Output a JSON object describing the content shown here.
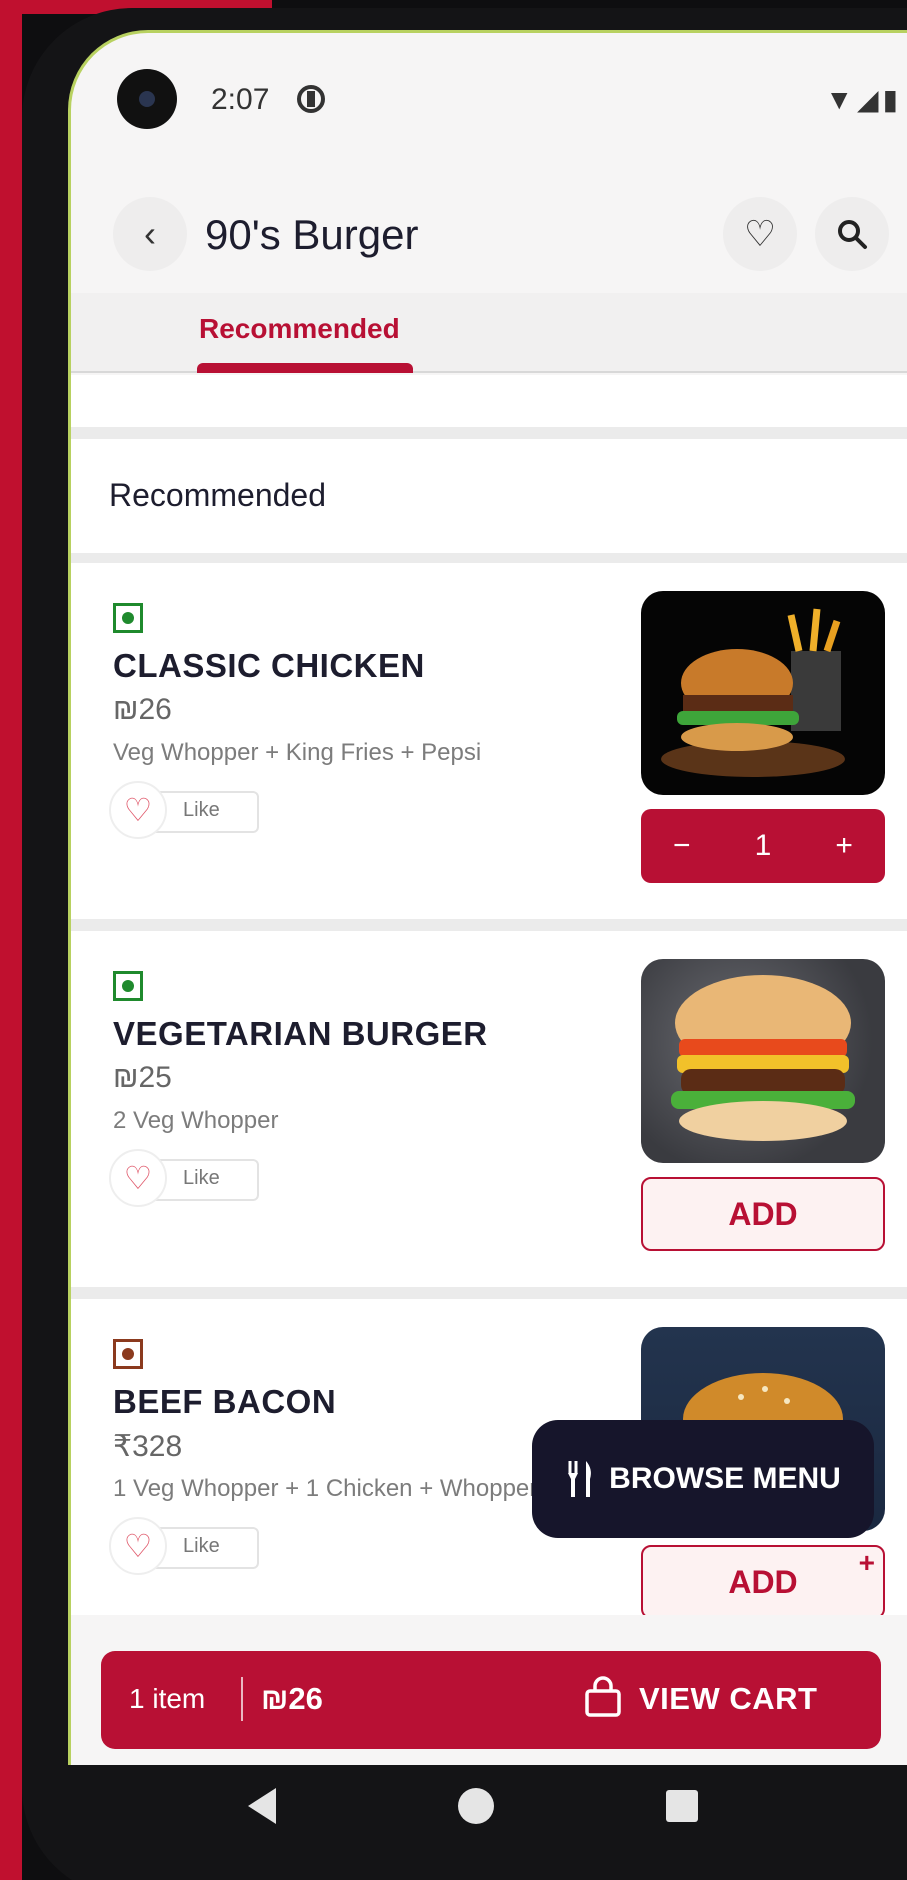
{
  "status_bar": {
    "time": "2:07",
    "icons": "▼◢▮"
  },
  "header": {
    "title": "90's Burger",
    "back_glyph": "‹",
    "fav_glyph": "♡",
    "search_glyph": "⚲"
  },
  "tabs": [
    {
      "label": "Recommended",
      "active": true
    }
  ],
  "section": {
    "title": "Recommended"
  },
  "items": [
    {
      "name": "CLASSIC CHICKEN",
      "price": "₪26",
      "description": "Veg Whopper + King Fries + Pepsi",
      "like_label": "Like",
      "type": "veg",
      "quantity": "1",
      "minus": "−",
      "plus": "+",
      "image_icon": "burger-fries-image"
    },
    {
      "name": " VEGETARIAN BURGER",
      "price": "₪25",
      "description": "2 Veg Whopper",
      "like_label": "Like",
      "type": "veg",
      "action_label": "ADD",
      "image_icon": "burger-image"
    },
    {
      "name": "BEEF BACON",
      "price": "₹328",
      "description": "1 Veg Whopper + 1 Chicken + Whopper",
      "like_label": "Like",
      "type": "non-veg",
      "action_label": "ADD",
      "action_plus": "+",
      "image_icon": "burger-image"
    }
  ],
  "browse_menu": {
    "label": "BROWSE MENU",
    "icon": "fork-knife-icon"
  },
  "cart": {
    "count": "1 item",
    "total": "₪26",
    "action": "VIEW CART"
  },
  "colors": {
    "accent": "#b81034",
    "dark": "#16152b",
    "veg": "#1f8a2d",
    "nonveg": "#8b3a1e"
  }
}
